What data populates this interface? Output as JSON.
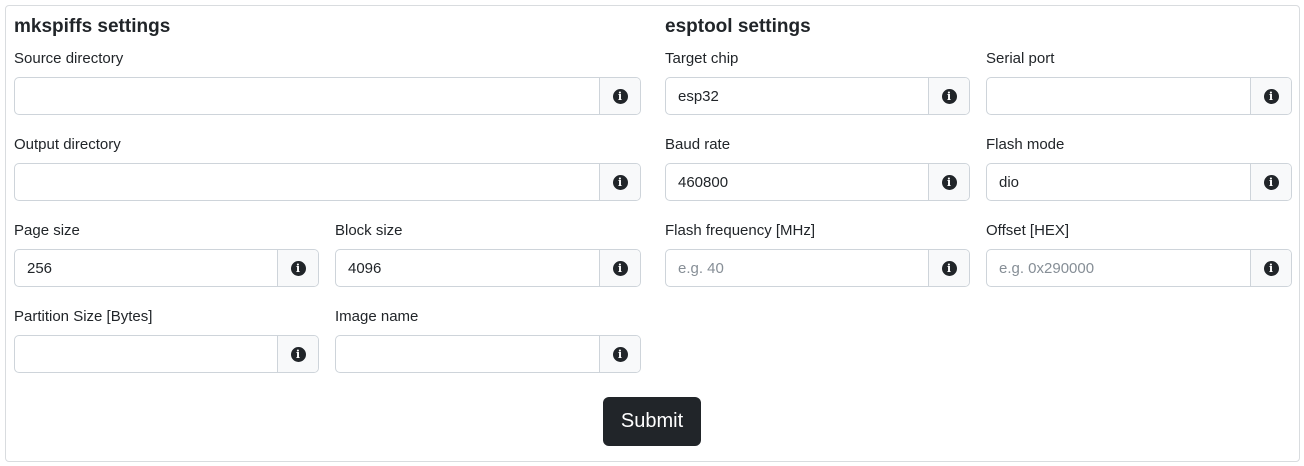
{
  "mkspiffs": {
    "title": "mkspiffs settings",
    "source_dir": {
      "label": "Source directory",
      "value": "",
      "placeholder": ""
    },
    "output_dir": {
      "label": "Output directory",
      "value": "",
      "placeholder": ""
    },
    "page_size": {
      "label": "Page size",
      "value": "256",
      "placeholder": ""
    },
    "block_size": {
      "label": "Block size",
      "value": "4096",
      "placeholder": ""
    },
    "partition_size": {
      "label": "Partition Size [Bytes]",
      "value": "",
      "placeholder": ""
    },
    "image_name": {
      "label": "Image name",
      "value": "",
      "placeholder": ""
    }
  },
  "esptool": {
    "title": "esptool settings",
    "target_chip": {
      "label": "Target chip",
      "value": "esp32",
      "placeholder": ""
    },
    "serial_port": {
      "label": "Serial port",
      "value": "",
      "placeholder": ""
    },
    "baud_rate": {
      "label": "Baud rate",
      "value": "460800",
      "placeholder": ""
    },
    "flash_mode": {
      "label": "Flash mode",
      "value": "dio",
      "placeholder": ""
    },
    "flash_freq": {
      "label": "Flash frequency [MHz]",
      "value": "",
      "placeholder": "e.g. 40"
    },
    "offset": {
      "label": "Offset [HEX]",
      "value": "",
      "placeholder": "e.g. 0x290000"
    }
  },
  "icons": {
    "info": "info-circle-icon",
    "info_glyph": "i"
  },
  "submit_label": "Submit"
}
